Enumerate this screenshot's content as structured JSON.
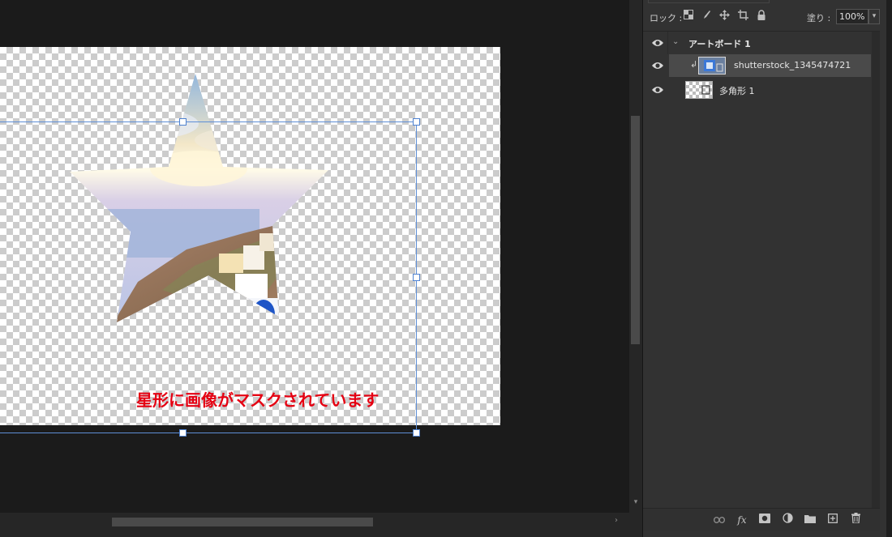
{
  "canvas": {
    "caption": "星形に画像がマスクされています",
    "caption_color": "#e50012",
    "selection_color": "#5f8fd6"
  },
  "layers_panel": {
    "lock_label": "ロック :",
    "lock_icons": [
      "lock-transparent-pixels-icon",
      "lock-image-pixels-icon",
      "lock-position-icon",
      "lock-artboard-icon",
      "lock-all-icon"
    ],
    "fill_label": "塗り :",
    "fill_value": "100%",
    "layers": [
      {
        "name": "アートボード 1",
        "type": "artboard",
        "visible": true,
        "expanded": true
      },
      {
        "name": "shutterstock_1345474721",
        "type": "smart-object",
        "visible": true,
        "clipped": true,
        "selected": true
      },
      {
        "name": "多角形 1",
        "type": "shape",
        "visible": true
      }
    ],
    "footer_icons": [
      "link-layers-icon",
      "fx-icon",
      "add-mask-icon",
      "adjustment-layer-icon",
      "new-group-icon",
      "new-layer-icon",
      "delete-layer-icon"
    ]
  }
}
